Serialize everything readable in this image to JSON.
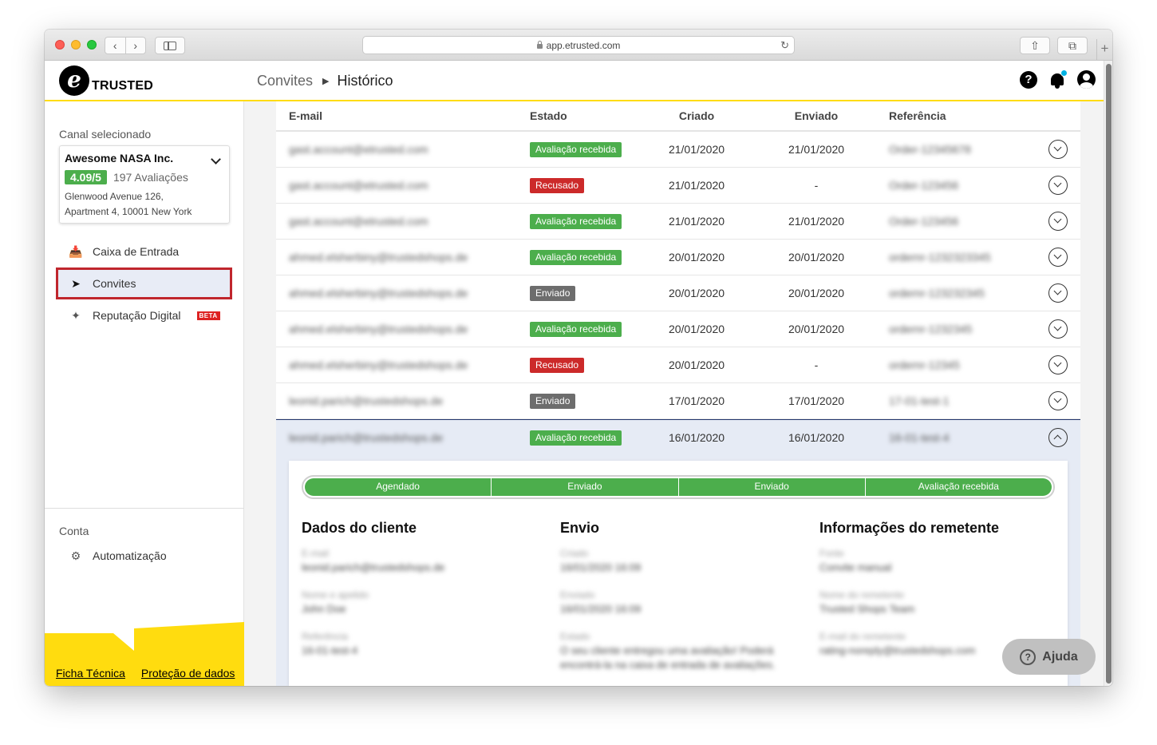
{
  "browser": {
    "url": "app.etrusted.com",
    "nav_back": "‹",
    "nav_forward": "›",
    "reload": "↻",
    "share": "⇧",
    "tabs": "⧉",
    "new_tab": "+"
  },
  "header": {
    "logo_mark": "e",
    "logo_text": "TRUSTED",
    "breadcrumb_root": "Convites",
    "breadcrumb_sep": "▶",
    "breadcrumb_current": "Histórico",
    "help": "?"
  },
  "sidebar": {
    "channel_label": "Canal selecionado",
    "channel_name": "Awesome NASA Inc.",
    "rating": "4.09/5",
    "reviews": "197 Avaliações",
    "address_line1": "Glenwood Avenue 126,",
    "address_line2": "Apartment 4, 10001 New York",
    "items": [
      {
        "label": "Caixa de Entrada",
        "icon": "inbox-icon"
      },
      {
        "label": "Convites",
        "icon": "paper-plane-icon"
      },
      {
        "label": "Reputação Digital",
        "icon": "sparkle-icon",
        "badge": "BETA"
      }
    ],
    "account_label": "Conta",
    "account_items": [
      {
        "label": "Automatização",
        "icon": "gear-robot-icon"
      }
    ],
    "footer_links": [
      "Ficha Técnica",
      "Proteção de dados"
    ],
    "footer_color": "#ffdc0f"
  },
  "table": {
    "headers": {
      "email": "E-mail",
      "status": "Estado",
      "created": "Criado",
      "sent": "Enviado",
      "reference": "Referência"
    },
    "rows": [
      {
        "email": "gast.account@etrusted.com",
        "status": "Avaliação recebida",
        "status_type": "green",
        "created": "21/01/2020",
        "sent": "21/01/2020",
        "reference": "Order-12345678"
      },
      {
        "email": "gast.account@etrusted.com",
        "status": "Recusado",
        "status_type": "red",
        "created": "21/01/2020",
        "sent": "-",
        "reference": "Order-123456"
      },
      {
        "email": "gast.account@etrusted.com",
        "status": "Avaliação recebida",
        "status_type": "green",
        "created": "21/01/2020",
        "sent": "21/01/2020",
        "reference": "Order-123456"
      },
      {
        "email": "ahmed.elsherbiny@trustedshops.de",
        "status": "Avaliação recebida",
        "status_type": "green",
        "created": "20/01/2020",
        "sent": "20/01/2020",
        "reference": "ordernr-1232323345"
      },
      {
        "email": "ahmed.elsherbiny@trustedshops.de",
        "status": "Enviado",
        "status_type": "gray",
        "created": "20/01/2020",
        "sent": "20/01/2020",
        "reference": "ordernr-123232345"
      },
      {
        "email": "ahmed.elsherbiny@trustedshops.de",
        "status": "Avaliação recebida",
        "status_type": "green",
        "created": "20/01/2020",
        "sent": "20/01/2020",
        "reference": "ordernr-1232345"
      },
      {
        "email": "ahmed.elsherbiny@trustedshops.de",
        "status": "Recusado",
        "status_type": "red",
        "created": "20/01/2020",
        "sent": "-",
        "reference": "ordernr-12345"
      },
      {
        "email": "leonid.parich@trustedshops.de",
        "status": "Enviado",
        "status_type": "gray",
        "created": "17/01/2020",
        "sent": "17/01/2020",
        "reference": "17-01-test-1"
      },
      {
        "email": "leonid.parich@trustedshops.de",
        "status": "Avaliação recebida",
        "status_type": "green",
        "created": "16/01/2020",
        "sent": "16/01/2020",
        "reference": "16-01-test-4"
      }
    ]
  },
  "detail": {
    "progress_steps": [
      "Agendado",
      "Enviado",
      "Enviado",
      "Avaliação recebida"
    ],
    "customer": {
      "title": "Dados do cliente",
      "fields": [
        {
          "label": "E-mail",
          "value": "leonid.parich@trustedshops.de"
        },
        {
          "label": "Nome e apelido",
          "value": "John Doe"
        },
        {
          "label": "Referência",
          "value": "16-01-test-4"
        }
      ]
    },
    "sending": {
      "title": "Envio",
      "fields": [
        {
          "label": "Criado",
          "value": "16/01/2020 16:09"
        },
        {
          "label": "Enviado",
          "value": "16/01/2020 16:09"
        },
        {
          "label": "Estado",
          "value": "O seu cliente entregou uma avaliação! Poderá encontrá-la na caixa de entrada de avaliações."
        }
      ]
    },
    "sender": {
      "title": "Informações do remetente",
      "fields": [
        {
          "label": "Fonte",
          "value": "Convite manual"
        },
        {
          "label": "Nome do remetente",
          "value": "Trusted Shops Team"
        },
        {
          "label": "E-mail do remetente",
          "value": "rating-noreply@trustedshops.com"
        }
      ]
    }
  },
  "help_button": {
    "label": "Ajuda",
    "icon": "?"
  }
}
